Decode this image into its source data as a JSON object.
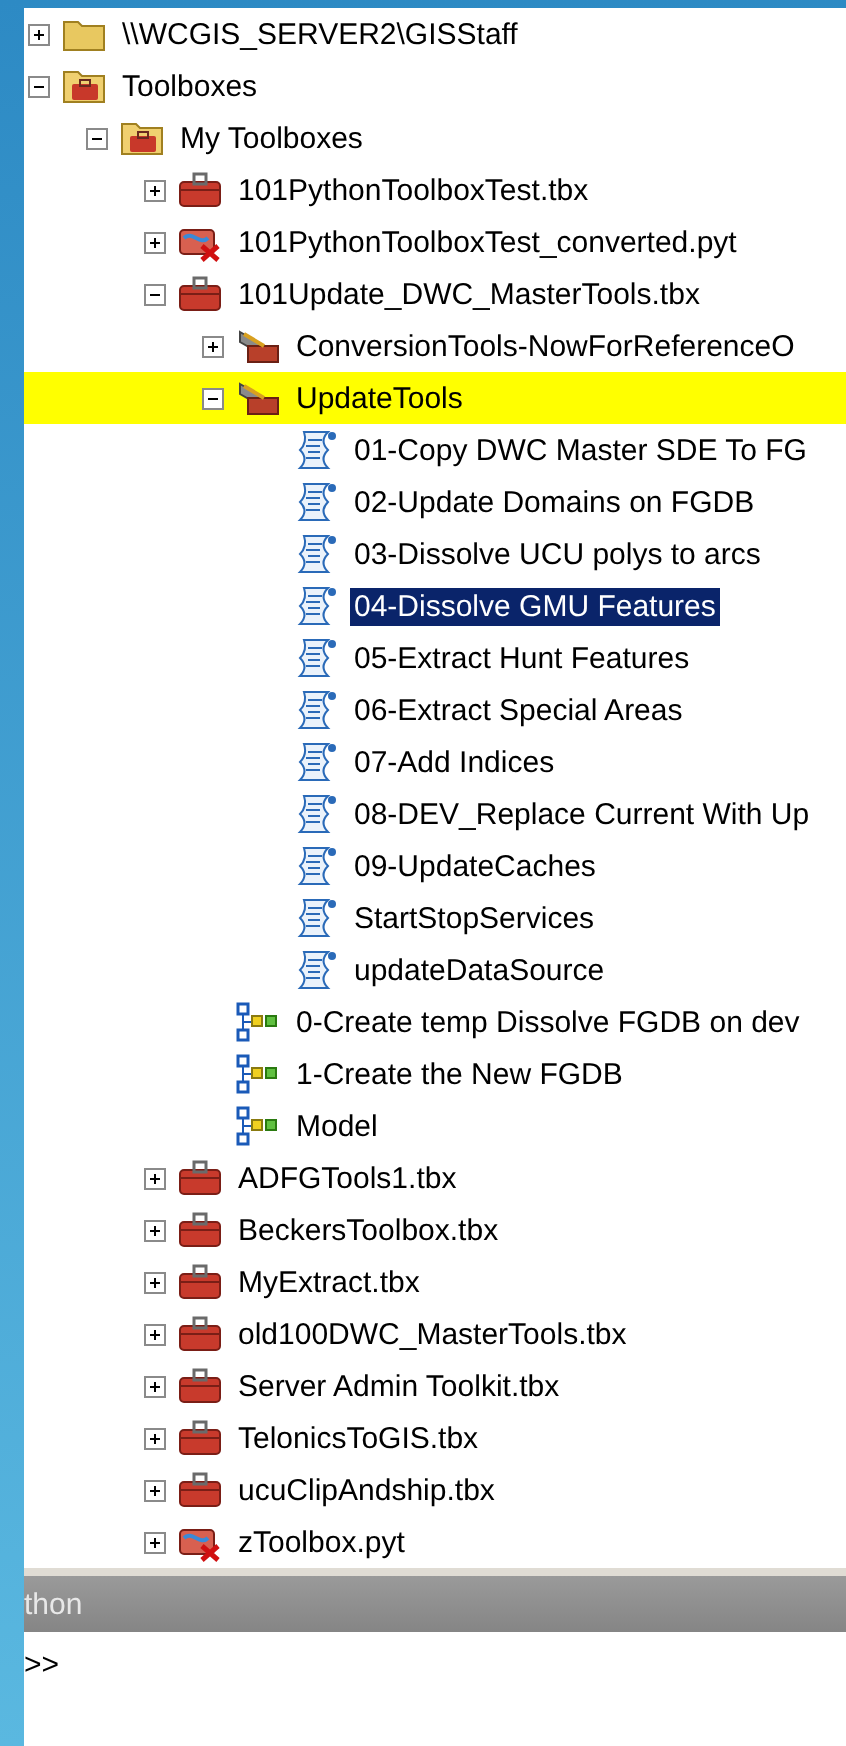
{
  "tree": [
    {
      "label": "\\\\WCGIS_SERVER2\\GISStaff",
      "kind": "drive",
      "expanded": false,
      "selected": false,
      "highlighted": false
    },
    {
      "label": "Toolboxes",
      "kind": "folder",
      "expanded": true,
      "selected": false,
      "highlighted": false,
      "children": [
        {
          "label": "My Toolboxes",
          "kind": "folder",
          "expanded": true,
          "selected": false,
          "highlighted": false,
          "children": [
            {
              "label": "101PythonToolboxTest.tbx",
              "kind": "toolbox",
              "expanded": false,
              "selected": false,
              "highlighted": false
            },
            {
              "label": "101PythonToolboxTest_converted.pyt",
              "kind": "pytoolbox",
              "expanded": false,
              "selected": false,
              "highlighted": false
            },
            {
              "label": "101Update_DWC_MasterTools.tbx",
              "kind": "toolbox",
              "expanded": true,
              "selected": false,
              "highlighted": false,
              "children": [
                {
                  "label": "ConversionTools-NowForReferenceO",
                  "kind": "toolset",
                  "expanded": false,
                  "selected": false,
                  "highlighted": false
                },
                {
                  "label": "UpdateTools",
                  "kind": "toolset",
                  "expanded": true,
                  "selected": false,
                  "highlighted": true,
                  "children": [
                    {
                      "label": "01-Copy DWC Master SDE To FG",
                      "kind": "script",
                      "selected": false,
                      "highlighted": false
                    },
                    {
                      "label": "02-Update Domains on FGDB",
                      "kind": "script",
                      "selected": false,
                      "highlighted": false
                    },
                    {
                      "label": "03-Dissolve UCU polys to arcs",
                      "kind": "script",
                      "selected": false,
                      "highlighted": false
                    },
                    {
                      "label": "04-Dissolve GMU Features",
                      "kind": "script",
                      "selected": true,
                      "highlighted": false
                    },
                    {
                      "label": "05-Extract Hunt Features",
                      "kind": "script",
                      "selected": false,
                      "highlighted": false
                    },
                    {
                      "label": "06-Extract Special Areas",
                      "kind": "script",
                      "selected": false,
                      "highlighted": false
                    },
                    {
                      "label": "07-Add Indices",
                      "kind": "script",
                      "selected": false,
                      "highlighted": false
                    },
                    {
                      "label": "08-DEV_Replace Current With Up",
                      "kind": "script",
                      "selected": false,
                      "highlighted": false
                    },
                    {
                      "label": "09-UpdateCaches",
                      "kind": "script",
                      "selected": false,
                      "highlighted": false
                    },
                    {
                      "label": "StartStopServices",
                      "kind": "script",
                      "selected": false,
                      "highlighted": false
                    },
                    {
                      "label": "updateDataSource",
                      "kind": "script",
                      "selected": false,
                      "highlighted": false
                    }
                  ]
                },
                {
                  "label": "0-Create temp Dissolve FGDB on dev",
                  "kind": "model",
                  "selected": false,
                  "highlighted": false
                },
                {
                  "label": "1-Create the New FGDB",
                  "kind": "model",
                  "selected": false,
                  "highlighted": false
                },
                {
                  "label": "Model",
                  "kind": "model",
                  "selected": false,
                  "highlighted": false
                }
              ]
            },
            {
              "label": "ADFGTools1.tbx",
              "kind": "toolbox",
              "expanded": false,
              "selected": false,
              "highlighted": false
            },
            {
              "label": "BeckersToolbox.tbx",
              "kind": "toolbox",
              "expanded": false,
              "selected": false,
              "highlighted": false
            },
            {
              "label": "MyExtract.tbx",
              "kind": "toolbox",
              "expanded": false,
              "selected": false,
              "highlighted": false
            },
            {
              "label": "old100DWC_MasterTools.tbx",
              "kind": "toolbox",
              "expanded": false,
              "selected": false,
              "highlighted": false
            },
            {
              "label": "Server Admin Toolkit.tbx",
              "kind": "toolbox",
              "expanded": false,
              "selected": false,
              "highlighted": false
            },
            {
              "label": "TelonicsToGIS.tbx",
              "kind": "toolbox",
              "expanded": false,
              "selected": false,
              "highlighted": false
            },
            {
              "label": "ucuClipAndship.tbx",
              "kind": "toolbox",
              "expanded": false,
              "selected": false,
              "highlighted": false
            },
            {
              "label": "zToolbox.pyt",
              "kind": "pytoolbox",
              "expanded": false,
              "selected": false,
              "highlighted": false
            }
          ]
        }
      ]
    }
  ],
  "python_panel": {
    "title": "thon",
    "prompt": ">>"
  }
}
